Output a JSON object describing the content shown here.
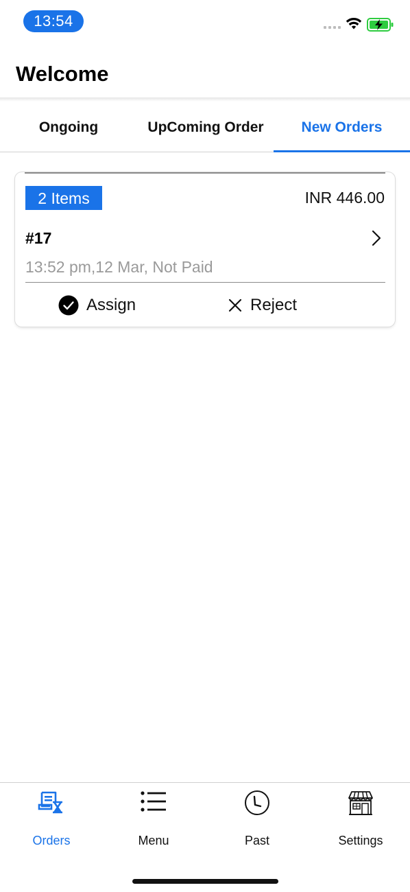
{
  "status_bar": {
    "time": "13:54"
  },
  "header": {
    "title": "Welcome"
  },
  "tabs": [
    {
      "label": "Ongoing"
    },
    {
      "label": "UpComing Order"
    },
    {
      "label": "New Orders",
      "active": true
    }
  ],
  "order": {
    "items_label": "2 Items",
    "amount": "INR 446.00",
    "number": "#17",
    "meta": "13:52 pm,12 Mar, Not Paid",
    "assign_label": "Assign",
    "reject_label": "Reject"
  },
  "bottom_nav": [
    {
      "label": "Orders",
      "icon": "orders-icon",
      "active": true
    },
    {
      "label": "Menu",
      "icon": "list-icon"
    },
    {
      "label": "Past",
      "icon": "clock-icon"
    },
    {
      "label": "Settings",
      "icon": "store-icon"
    }
  ],
  "colors": {
    "accent": "#1a73e8",
    "battery": "#2ecc40"
  }
}
